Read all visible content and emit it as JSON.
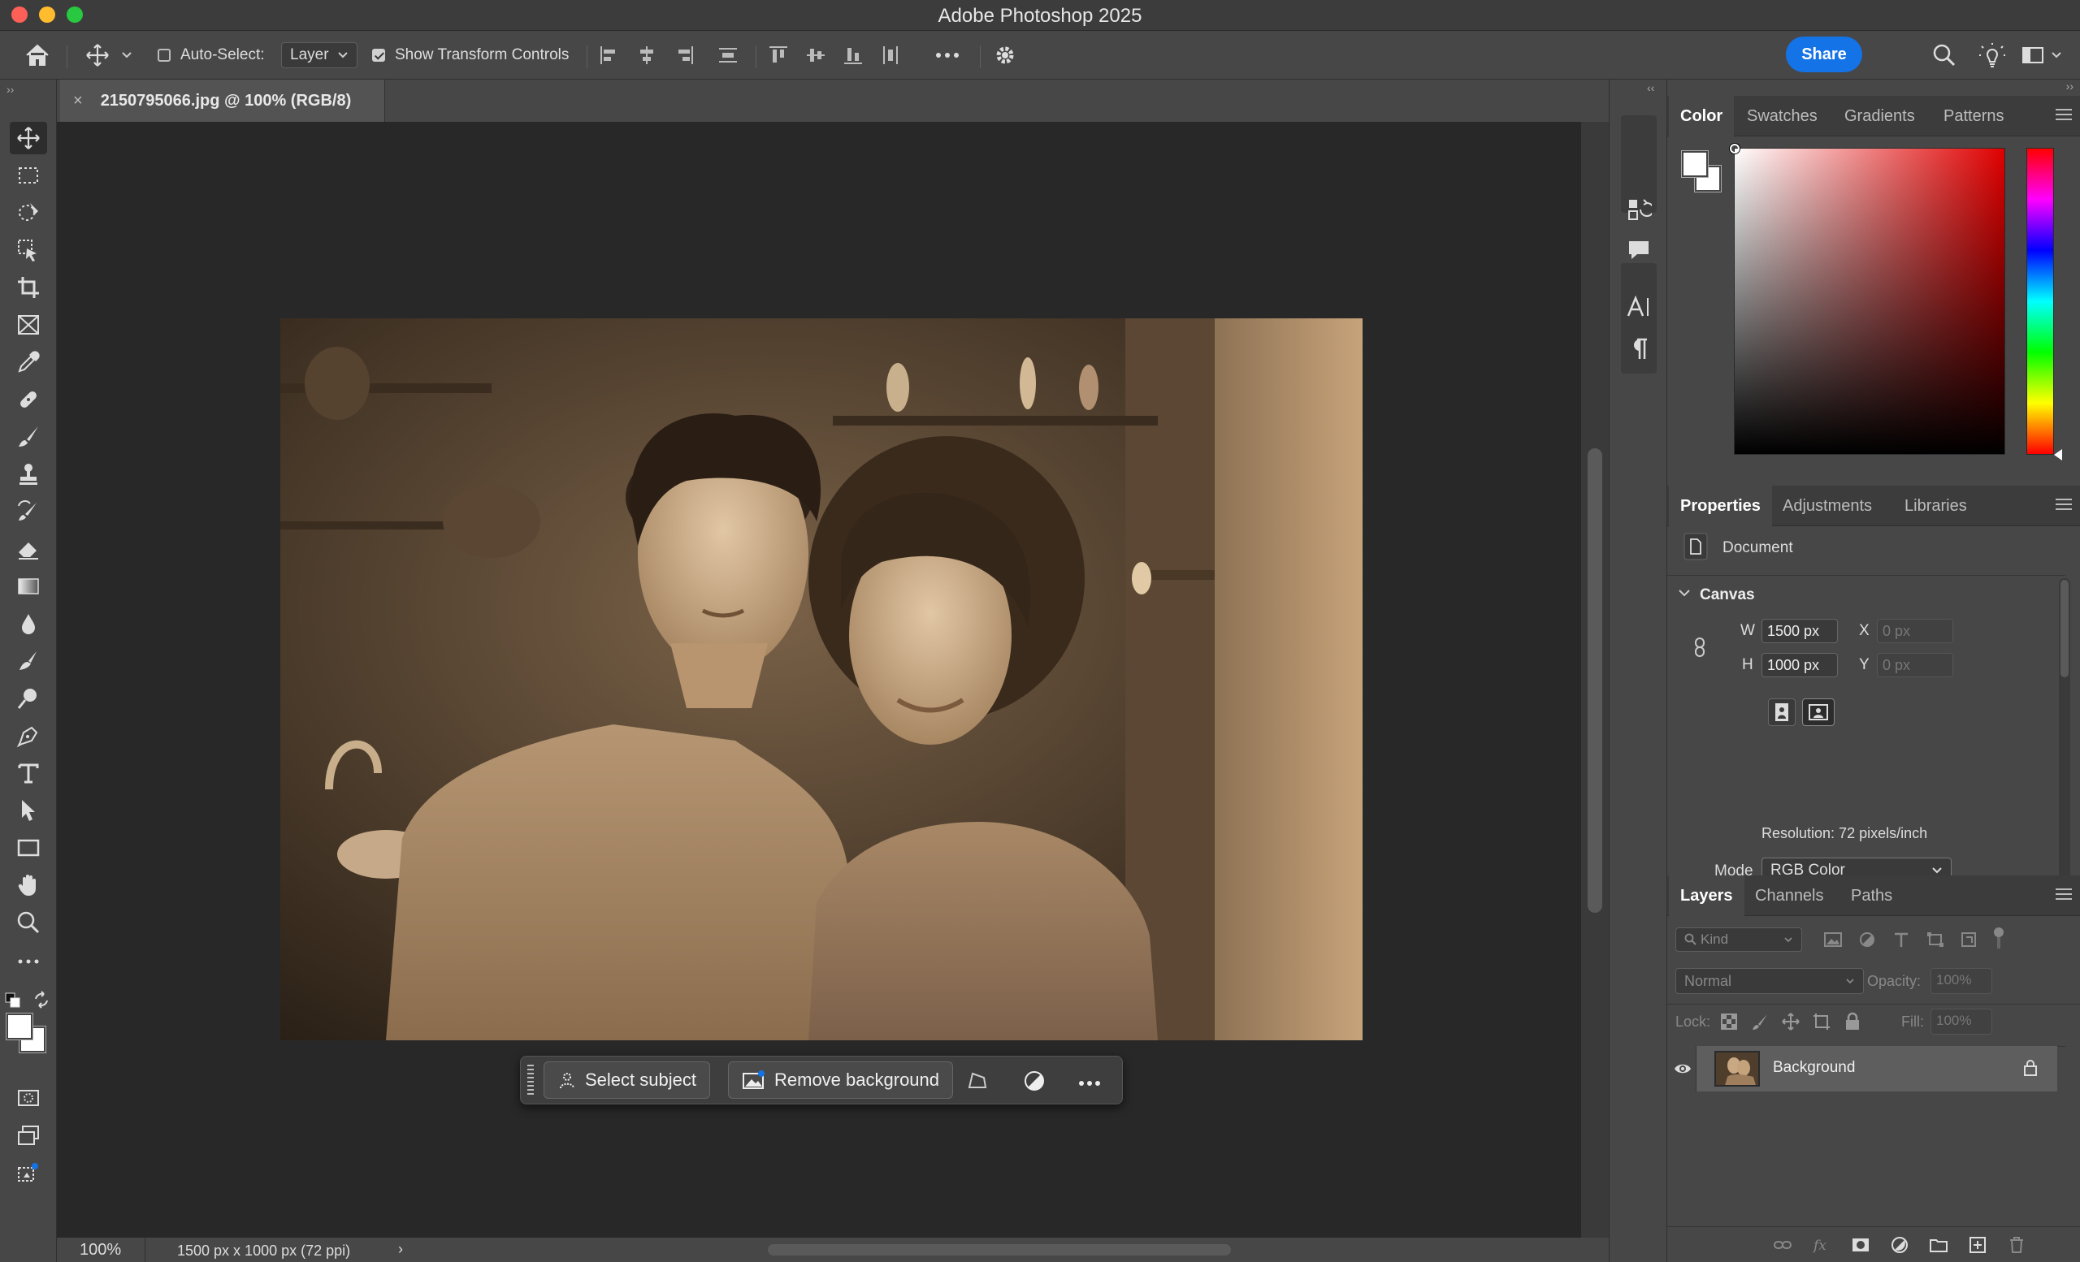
{
  "app": {
    "window_title": "Adobe Photoshop 2025"
  },
  "options_bar": {
    "auto_select_label": "Auto-Select:",
    "auto_select_checked": false,
    "auto_select_target": "Layer",
    "show_transform_label": "Show Transform Controls",
    "show_transform_checked": true,
    "share_label": "Share"
  },
  "document": {
    "tab_title": "2150795066.jpg @ 100% (RGB/8)",
    "zoom": "100%",
    "info": "1500 px x 1000 px (72 ppi)"
  },
  "contextual_taskbar": {
    "select_subject": "Select subject",
    "remove_background": "Remove background"
  },
  "color_panel": {
    "tabs": [
      "Color",
      "Swatches",
      "Gradients",
      "Patterns"
    ],
    "active_tab": "Color",
    "hue_color": "#e00000"
  },
  "properties_panel": {
    "tabs": [
      "Properties",
      "Adjustments",
      "Libraries"
    ],
    "section_label": "Document",
    "canvas_label": "Canvas",
    "w_label": "W",
    "width": "1500 px",
    "h_label": "H",
    "height": "1000 px",
    "x_label": "X",
    "x_placeholder": "0 px",
    "y_label": "Y",
    "y_placeholder": "0 px",
    "resolution": "Resolution: 72 pixels/inch",
    "mode_label": "Mode",
    "mode_value": "RGB Color"
  },
  "layers_panel": {
    "tabs": [
      "Layers",
      "Channels",
      "Paths"
    ],
    "filter_kind": "Kind",
    "blend_mode": "Normal",
    "opacity_label": "Opacity:",
    "opacity_value": "100%",
    "lock_label": "Lock:",
    "fill_label": "Fill:",
    "fill_value": "100%",
    "layers": [
      {
        "name": "Background",
        "visible": true,
        "locked": true
      }
    ]
  },
  "colors": {
    "accent": "#1473e6",
    "panel": "#474747",
    "canvas": "#282828"
  }
}
